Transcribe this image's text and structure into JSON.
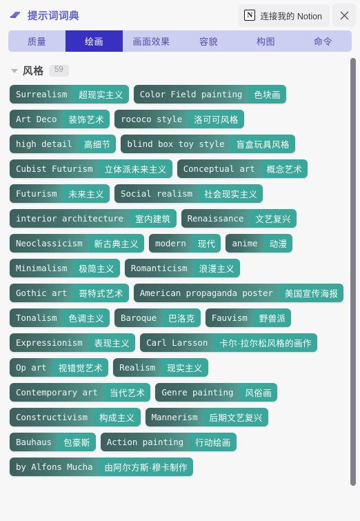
{
  "header": {
    "app_title": "提示词词典",
    "app_icon": "book-icon",
    "notion_button_label": "连接我的 Notion",
    "notion_icon_letter": "N",
    "close_icon": "✕"
  },
  "tabs": [
    {
      "label": "质量",
      "active": false
    },
    {
      "label": "绘画",
      "active": true
    },
    {
      "label": "画面效果",
      "active": false
    },
    {
      "label": "容貌",
      "active": false
    },
    {
      "label": "构图",
      "active": false
    },
    {
      "label": "命令",
      "active": false
    }
  ],
  "section": {
    "title": "风格",
    "count": "59",
    "expanded": true
  },
  "colors": {
    "brand_purple": "#5b5fd0",
    "tab_bar_bg": "#ccd0f0",
    "tab_active_bg": "#3730c0",
    "tag_en_start": "#3d5f5d",
    "tag_en_end": "#54a096",
    "tag_zh_bg": "#3ba79b",
    "page_bg": "#f7f7f8",
    "scrollbar": "#808086"
  },
  "tags": [
    {
      "en": "Surrealism",
      "zh": "超现实主义"
    },
    {
      "en": "Color Field painting",
      "zh": "色块画"
    },
    {
      "en": "Art Deco",
      "zh": "装饰艺术"
    },
    {
      "en": "rococo style",
      "zh": "洛可可风格"
    },
    {
      "en": "high detail",
      "zh": "高细节"
    },
    {
      "en": "blind box toy style",
      "zh": "盲盒玩具风格"
    },
    {
      "en": "Cubist Futurism",
      "zh": "立体派未来主义"
    },
    {
      "en": "Conceptual art",
      "zh": "概念艺术"
    },
    {
      "en": "Futurism",
      "zh": "未来主义"
    },
    {
      "en": "Social realism",
      "zh": "社会现实主义"
    },
    {
      "en": "interior architecture",
      "zh": "室内建筑"
    },
    {
      "en": "Renaissance",
      "zh": "文艺复兴"
    },
    {
      "en": "Neoclassicism",
      "zh": "新古典主义"
    },
    {
      "en": "modern",
      "zh": "现代"
    },
    {
      "en": "anime",
      "zh": "动漫"
    },
    {
      "en": "Minimalism",
      "zh": "极简主义"
    },
    {
      "en": "Romanticism",
      "zh": "浪漫主义"
    },
    {
      "en": "Gothic art",
      "zh": "哥特式艺术"
    },
    {
      "en": "American propaganda poster",
      "zh": "美国宣传海报"
    },
    {
      "en": "Tonalism",
      "zh": "色调主义"
    },
    {
      "en": "Baroque",
      "zh": "巴洛克"
    },
    {
      "en": "Fauvism",
      "zh": "野兽派"
    },
    {
      "en": "Expressionism",
      "zh": "表现主义"
    },
    {
      "en": "Carl Larsson",
      "zh": "卡尔·拉尔松风格的画作"
    },
    {
      "en": "Op art",
      "zh": "视错觉艺术"
    },
    {
      "en": "Realism",
      "zh": "现实主义"
    },
    {
      "en": "Contemporary art",
      "zh": "当代艺术"
    },
    {
      "en": "Genre painting",
      "zh": "风俗画"
    },
    {
      "en": "Constructivism",
      "zh": "构成主义"
    },
    {
      "en": "Mannerism",
      "zh": "后期文艺复兴"
    },
    {
      "en": "Bauhaus",
      "zh": "包豪斯"
    },
    {
      "en": "Action painting",
      "zh": "行动绘画"
    },
    {
      "en": "by Alfons Mucha",
      "zh": "由阿尔方斯·穆卡制作"
    }
  ]
}
